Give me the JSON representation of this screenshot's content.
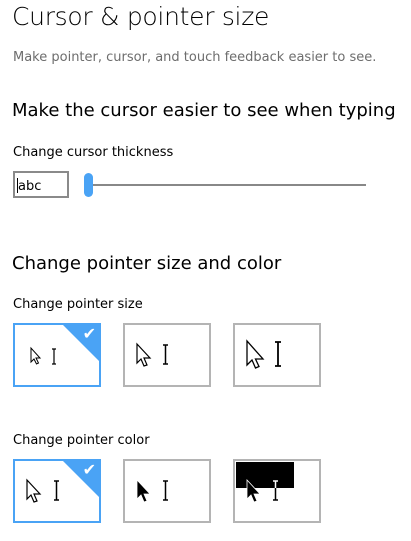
{
  "page": {
    "title": "Cursor & pointer size",
    "description": "Make pointer, cursor, and touch feedback easier to see."
  },
  "cursor_section": {
    "heading": "Make the cursor easier to see when typing",
    "thickness_label": "Change cursor thickness",
    "preview_text": "abc",
    "thickness_value": 1
  },
  "pointer_section": {
    "heading": "Change pointer size and color",
    "size_label": "Change pointer size",
    "size_options": [
      {
        "size": "small",
        "selected": true
      },
      {
        "size": "medium",
        "selected": false
      },
      {
        "size": "large",
        "selected": false
      }
    ],
    "color_label": "Change pointer color",
    "color_options": [
      {
        "color": "white",
        "selected": true
      },
      {
        "color": "black",
        "selected": false
      },
      {
        "color": "inverted",
        "selected": false
      }
    ],
    "check_glyph": "✔"
  },
  "colors": {
    "accent": "#4aa3f5",
    "border": "#b4b4b4"
  }
}
